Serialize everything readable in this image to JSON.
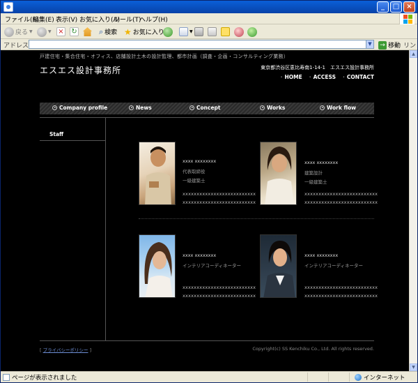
{
  "window": {
    "controls": {
      "minimize": "_",
      "maximize": "□",
      "close": "×"
    }
  },
  "menubar": {
    "items": [
      "ファイル(F)",
      "編集(E)",
      "表示(V)",
      "お気に入り(A)",
      "ツール(T)",
      "ヘルプ(H)"
    ]
  },
  "toolbar": {
    "back_label": "戻る",
    "search_label": "検索",
    "favorites_label": "お気に入り"
  },
  "addressbar": {
    "label": "アドレス(D)",
    "value": "",
    "go_label": "移動",
    "links_label": "リンク"
  },
  "site": {
    "tagline": "戸建住宅・集合住宅・オフィス、店舗設計土木の設計監理、都市計画（調査・企画・コンサルティング業務）",
    "name": "エスエス設計事務所",
    "address": "東京都渋谷区恵比寿南1-14-1　エスエス設計事務所",
    "topnav": [
      "HOME",
      "ACCESS",
      "CONTACT"
    ],
    "mainnav": [
      "Company profile",
      "News",
      "Concept",
      "Works",
      "Work flow"
    ],
    "sidebar": {
      "staff_label": "Staff"
    },
    "staff": [
      {
        "name": "xxxx xxxxxxxx",
        "role1": "代表取締役",
        "role2": "一級建築士",
        "line1": "xxxxxxxxxxxxxxxxxxxxxxxxxx",
        "line2": "xxxxxxxxxxxxxxxxxxxxxxxxxx"
      },
      {
        "name": "xxxx xxxxxxxx",
        "role1": "建築設計",
        "role2": "一級建築士",
        "line1": "xxxxxxxxxxxxxxxxxxxxxxxxxx",
        "line2": "xxxxxxxxxxxxxxxxxxxxxxxxxx"
      },
      {
        "name": "xxxx xxxxxxxx",
        "role1": "インテリアコーディネーター",
        "role2": "",
        "line1": "xxxxxxxxxxxxxxxxxxxxxxxxxx",
        "line2": "xxxxxxxxxxxxxxxxxxxxxxxxxx"
      },
      {
        "name": "xxxx xxxxxxxx",
        "role1": "インテリアコーディネーター",
        "role2": "",
        "line1": "xxxxxxxxxxxxxxxxxxxxxxxxxx",
        "line2": "xxxxxxxxxxxxxxxxxxxxxxxxxx"
      }
    ],
    "footer": {
      "bracket_open": "[",
      "privacy_label": "プライバシーポリシー",
      "bracket_close": "]",
      "copyright": "Copyright(c) SS Kenchiku Co., Ltd. All rights reserved."
    }
  },
  "statusbar": {
    "text": "ページが表示されました",
    "zone": "インターネット"
  }
}
